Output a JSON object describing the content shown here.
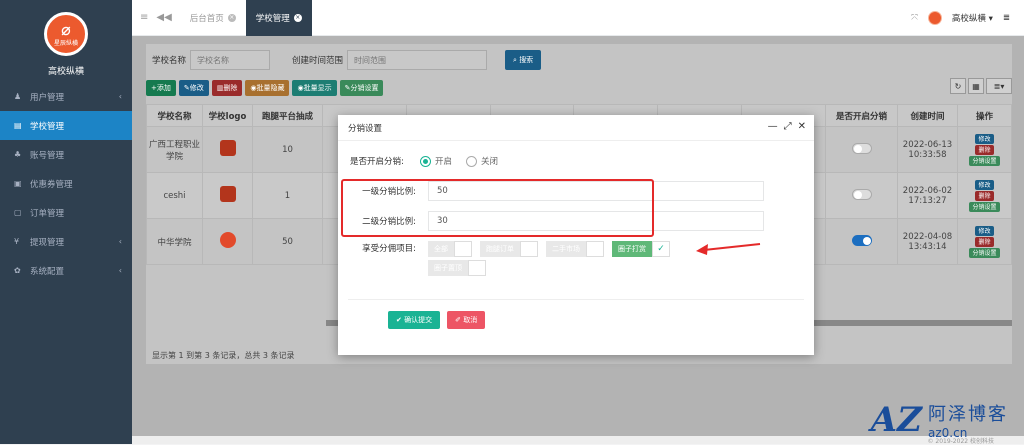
{
  "sidebar": {
    "logo_text": "星辰纵横",
    "app_name": "高校纵横",
    "items": [
      {
        "icon": "user-icon",
        "label": "用户管理",
        "has_arrow": true
      },
      {
        "icon": "doc-icon",
        "label": "学校管理",
        "active": true
      },
      {
        "icon": "users-icon",
        "label": "账号管理"
      },
      {
        "icon": "ticket-icon",
        "label": "优惠券管理"
      },
      {
        "icon": "order-icon",
        "label": "订单管理"
      },
      {
        "icon": "yen-icon",
        "label": "提现管理",
        "has_arrow": true
      },
      {
        "icon": "gear-icon",
        "label": "系统配置",
        "has_arrow": true
      }
    ]
  },
  "topbar": {
    "tabs": [
      {
        "label": "后台首页"
      },
      {
        "label": "学校管理"
      }
    ],
    "user_name": "高校纵横"
  },
  "search": {
    "school_label": "学校名称",
    "school_placeholder": "学校名称",
    "time_label": "创建时间范围",
    "time_placeholder": "时间范围",
    "search_button": "搜索"
  },
  "toolbar": {
    "add": "添加",
    "edit": "修改",
    "delete": "删除",
    "batch_hide": "批量隐藏",
    "batch_show": "批量显示",
    "distribution": "分销设置"
  },
  "table": {
    "headers": [
      "学校名称",
      "学校logo",
      "跑腿平台抽成",
      "",
      "",
      "",
      "",
      "",
      "",
      "是否开启分销",
      "创建时间",
      "操作"
    ],
    "rows": [
      {
        "name": "广西工程职业学院",
        "commission": "10",
        "distribution_on": false,
        "created": "2022-06-13 10:33:58"
      },
      {
        "name": "ceshi",
        "commission": "1",
        "distribution_on": false,
        "created": "2022-06-02 17:13:27"
      },
      {
        "name": "中华学院",
        "commission": "50",
        "distribution_on": true,
        "created": "2022-04-08 13:43:14"
      }
    ],
    "op_edit": "修改",
    "op_delete": "删除",
    "op_dist": "分销设置"
  },
  "pager": "显示第 1 到第 3 条记录，总共 3 条记录",
  "footer": "© 2019-2022 校创科技",
  "modal": {
    "title": "分销设置",
    "enable_label": "是否开启分销:",
    "enable_on": "开启",
    "enable_off": "关闭",
    "level1_label": "一级分销比例:",
    "level1_value": "50",
    "level2_label": "二级分销比例:",
    "level2_value": "30",
    "projects_label": "享受分佣项目:",
    "projects": [
      {
        "label": "全部",
        "checked": false
      },
      {
        "label": "跑腿订单",
        "checked": false
      },
      {
        "label": "二手市场",
        "checked": false
      },
      {
        "label": "圈子打赏",
        "checked": true
      },
      {
        "label": "圈子置顶",
        "checked": false
      }
    ],
    "confirm": "确认提交",
    "cancel": "取消"
  },
  "watermark": {
    "logo": "AZ",
    "cn": "阿泽博客",
    "en": "az0.cn"
  },
  "colors": {
    "sidebar": "#2f4050",
    "active": "#1c84c6",
    "annotation": "#e42a2a",
    "accent": "#1ab394"
  }
}
